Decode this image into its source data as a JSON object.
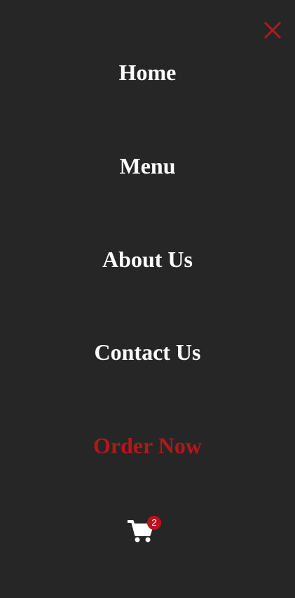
{
  "menu": {
    "items": [
      {
        "label": "Home"
      },
      {
        "label": "Menu"
      },
      {
        "label": "About Us"
      },
      {
        "label": "Contact Us"
      },
      {
        "label": "Order Now"
      }
    ]
  },
  "cart": {
    "icon": "cart-icon",
    "count": "2"
  },
  "close": {
    "icon": "close-icon"
  },
  "colors": {
    "background": "#262626",
    "text": "#ffffff",
    "accent": "#b5161c"
  }
}
